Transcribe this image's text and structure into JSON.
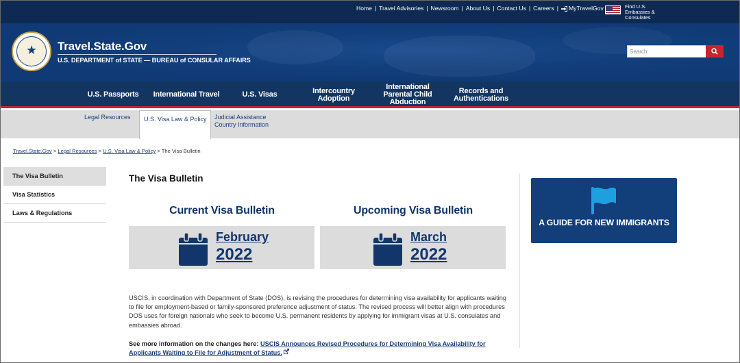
{
  "utility": {
    "links": [
      "Home",
      "Travel Advisories",
      "Newsroom",
      "About Us",
      "Contact Us",
      "Careers",
      "MyTravelGov"
    ],
    "embassy_text": "Find U.S. Embassies & Consulates"
  },
  "header": {
    "site_title": "Travel.State.Gov",
    "subtitle": "U.S. DEPARTMENT of STATE — BUREAU of CONSULAR AFFAIRS",
    "search_placeholder": "Search"
  },
  "mainnav": {
    "items": [
      "U.S. Passports",
      "International Travel",
      "U.S. Visas",
      "Intercountry Adoption",
      "International Parental Child Abduction",
      "Records and Authentications"
    ]
  },
  "subnav": {
    "items": [
      "Legal Resources",
      "U.S. Visa Law & Policy",
      "Judicial Assistance Country Information"
    ]
  },
  "breadcrumb": {
    "items": [
      "Travel.State.Gov",
      "Legal Resources",
      "U.S. Visa Law & Policy"
    ],
    "current": "The Visa Bulletin",
    "separator": ">"
  },
  "sidenav": {
    "items": [
      "The Visa Bulletin",
      "Visa Statistics",
      "Laws & Regulations"
    ]
  },
  "main": {
    "page_title": "The Visa Bulletin",
    "current": {
      "heading": "Current Visa Bulletin",
      "month": "February",
      "year": "2022"
    },
    "upcoming": {
      "heading": "Upcoming Visa Bulletin",
      "month": "March",
      "year": "2022"
    },
    "guide_text": "A GUIDE FOR NEW IMMIGRANTS",
    "paragraph": "USCIS, in coordination with Department of State (DOS), is revising the procedures for determining visa availability for applicants waiting to file for employment-based or family-sponsored preference adjustment of status. The revised process will better align with procedures DOS uses for foreign nationals who seek to become U.S. permanent residents by applying for immigrant visas at U.S. consulates and embassies abroad.",
    "more_info_label": "See more information on the changes here:",
    "more_info_link": "USCIS Announces Revised Procedures for Determining Visa Availability for Applicants Waiting to File for Adjustment of Status."
  },
  "colors": {
    "navy": "#123561",
    "brand_blue": "#12366b",
    "accent_red": "#c9242b",
    "panel_gray": "#dcdcdc",
    "flag_cyan": "#1ea0e0"
  }
}
